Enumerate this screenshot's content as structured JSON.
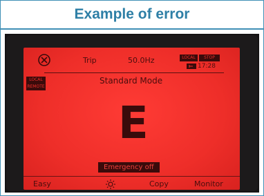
{
  "header": {
    "title": "Example of error"
  },
  "display": {
    "error_icon": "error-circle-x-icon",
    "trip_label": "Trip",
    "frequency": "50.0Hz",
    "mode_badge": "LOCAL",
    "stop_badge": "STOP",
    "clock_icon": "clock-icon",
    "time": "17:28",
    "local_remote_badge": "LOCAL REMOTE",
    "mode_label": "Standard Mode",
    "error_code": "E",
    "error_message": "Emergency off",
    "softkeys": {
      "left": "Easy",
      "center_icon": "sun-brightness-icon",
      "right_center": "Copy",
      "right": "Monitor"
    }
  },
  "colors": {
    "accent": "#2e7fa6",
    "lcd_background": "#ee2e29",
    "lcd_text": "#3a0b0b"
  }
}
